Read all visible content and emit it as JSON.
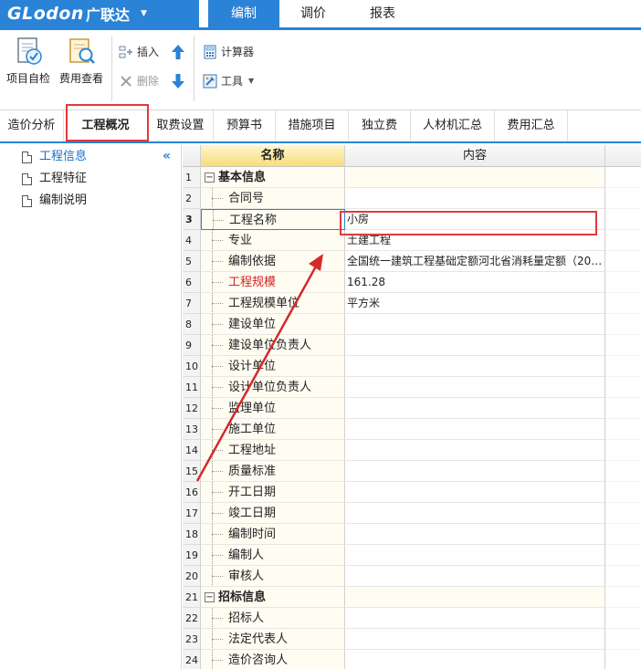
{
  "app": {
    "brand": "GLodon",
    "brand_cn": "广联达",
    "menu_tabs": [
      "编制",
      "调价",
      "报表"
    ],
    "active_menu": "编制"
  },
  "toolbar": {
    "self_check": "项目自检",
    "fee_view": "费用查看",
    "insert": "插入",
    "delete": "删除",
    "calculator": "计算器",
    "tools": "工具"
  },
  "tabs": [
    "造价分析",
    "工程概况",
    "取费设置",
    "预算书",
    "措施项目",
    "独立费",
    "人材机汇总",
    "费用汇总"
  ],
  "active_tab": "工程概况",
  "sidebar": {
    "items": [
      "工程信息",
      "工程特征",
      "编制说明"
    ],
    "active": "工程信息"
  },
  "grid": {
    "headers": [
      "名称",
      "内容"
    ],
    "rows": [
      {
        "num": "1",
        "name": "基本信息",
        "value": "",
        "type": "group"
      },
      {
        "num": "2",
        "name": "合同号",
        "value": "",
        "type": "child"
      },
      {
        "num": "3",
        "name": "工程名称",
        "value": "小房",
        "type": "child"
      },
      {
        "num": "4",
        "name": "专业",
        "value": "土建工程",
        "type": "child"
      },
      {
        "num": "5",
        "name": "编制依据",
        "value": "全国统一建筑工程基础定额河北省消耗量定额（20…",
        "type": "child"
      },
      {
        "num": "6",
        "name": "工程规模",
        "value": "161.28",
        "type": "child"
      },
      {
        "num": "7",
        "name": "工程规模单位",
        "value": "平方米",
        "type": "child"
      },
      {
        "num": "8",
        "name": "建设单位",
        "value": "",
        "type": "child"
      },
      {
        "num": "9",
        "name": "建设单位负责人",
        "value": "",
        "type": "child"
      },
      {
        "num": "10",
        "name": "设计单位",
        "value": "",
        "type": "child"
      },
      {
        "num": "11",
        "name": "设计单位负责人",
        "value": "",
        "type": "child"
      },
      {
        "num": "12",
        "name": "监理单位",
        "value": "",
        "type": "child"
      },
      {
        "num": "13",
        "name": "施工单位",
        "value": "",
        "type": "child"
      },
      {
        "num": "14",
        "name": "工程地址",
        "value": "",
        "type": "child"
      },
      {
        "num": "15",
        "name": "质量标准",
        "value": "",
        "type": "child"
      },
      {
        "num": "16",
        "name": "开工日期",
        "value": "",
        "type": "child"
      },
      {
        "num": "17",
        "name": "竣工日期",
        "value": "",
        "type": "child"
      },
      {
        "num": "18",
        "name": "编制时间",
        "value": "",
        "type": "child"
      },
      {
        "num": "19",
        "name": "编制人",
        "value": "",
        "type": "child"
      },
      {
        "num": "20",
        "name": "审核人",
        "value": "",
        "type": "child"
      },
      {
        "num": "21",
        "name": "招标信息",
        "value": "",
        "type": "group"
      },
      {
        "num": "22",
        "name": "招标人",
        "value": "",
        "type": "child"
      },
      {
        "num": "23",
        "name": "法定代表人",
        "value": "",
        "type": "child"
      },
      {
        "num": "24",
        "name": "造价咨询人",
        "value": "",
        "type": "child"
      }
    ]
  },
  "colors": {
    "accent": "#2a83d6",
    "highlight_red": "#e03a3a",
    "required_field_red": "#d21f1f"
  },
  "icons": [
    "check-doc-icon",
    "fee-search-icon",
    "insert-icon",
    "delete-icon",
    "move-up-icon",
    "move-down-icon",
    "calculator-icon",
    "tools-icon",
    "chevron-down-icon",
    "collapse-left-icon",
    "document-icon"
  ]
}
